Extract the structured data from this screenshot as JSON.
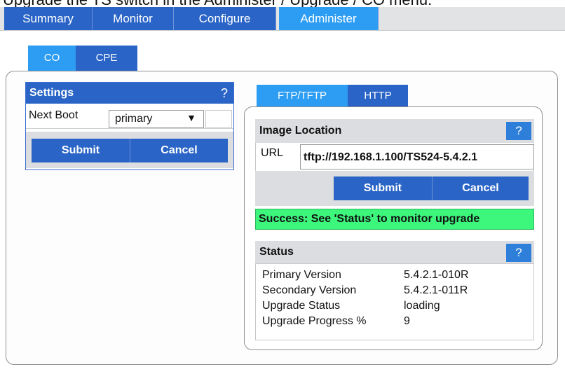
{
  "caption": "Upgrade the TS switch in the Administer / Upgrade / CO menu.",
  "top_tabs": [
    {
      "label": "Summary",
      "active": false
    },
    {
      "label": "Monitor",
      "active": false
    },
    {
      "label": "Configure",
      "active": false
    },
    {
      "label": "Administer",
      "active": true
    }
  ],
  "sub_tabs": [
    {
      "label": "CO",
      "active": true
    },
    {
      "label": "CPE",
      "active": false
    }
  ],
  "settings": {
    "title": "Settings",
    "help": "?",
    "next_boot_label": "Next Boot",
    "next_boot_value": "primary",
    "dropdown_arrow": "▼",
    "submit": "Submit",
    "cancel": "Cancel"
  },
  "protocol_tabs": [
    {
      "label": "FTP/TFTP",
      "active": true
    },
    {
      "label": "HTTP",
      "active": false
    }
  ],
  "image_location": {
    "title": "Image Location",
    "help": "?",
    "url_label": "URL",
    "url_value": "tftp://192.168.1.100/TS524-5.4.2.1",
    "submit": "Submit",
    "cancel": "Cancel",
    "message": "Success: See 'Status' to monitor upgrade"
  },
  "status": {
    "title": "Status",
    "help": "?",
    "rows": [
      {
        "key": "Primary Version",
        "value": "5.4.2.1-010R"
      },
      {
        "key": "Secondary Version",
        "value": "5.4.2.1-011R"
      },
      {
        "key": "Upgrade Status",
        "value": "loading"
      },
      {
        "key": "Upgrade Progress %",
        "value": "9"
      }
    ]
  },
  "colors": {
    "tab_dark": "#2a64c6",
    "tab_active": "#2d9df4",
    "success_green": "#3df67c"
  }
}
